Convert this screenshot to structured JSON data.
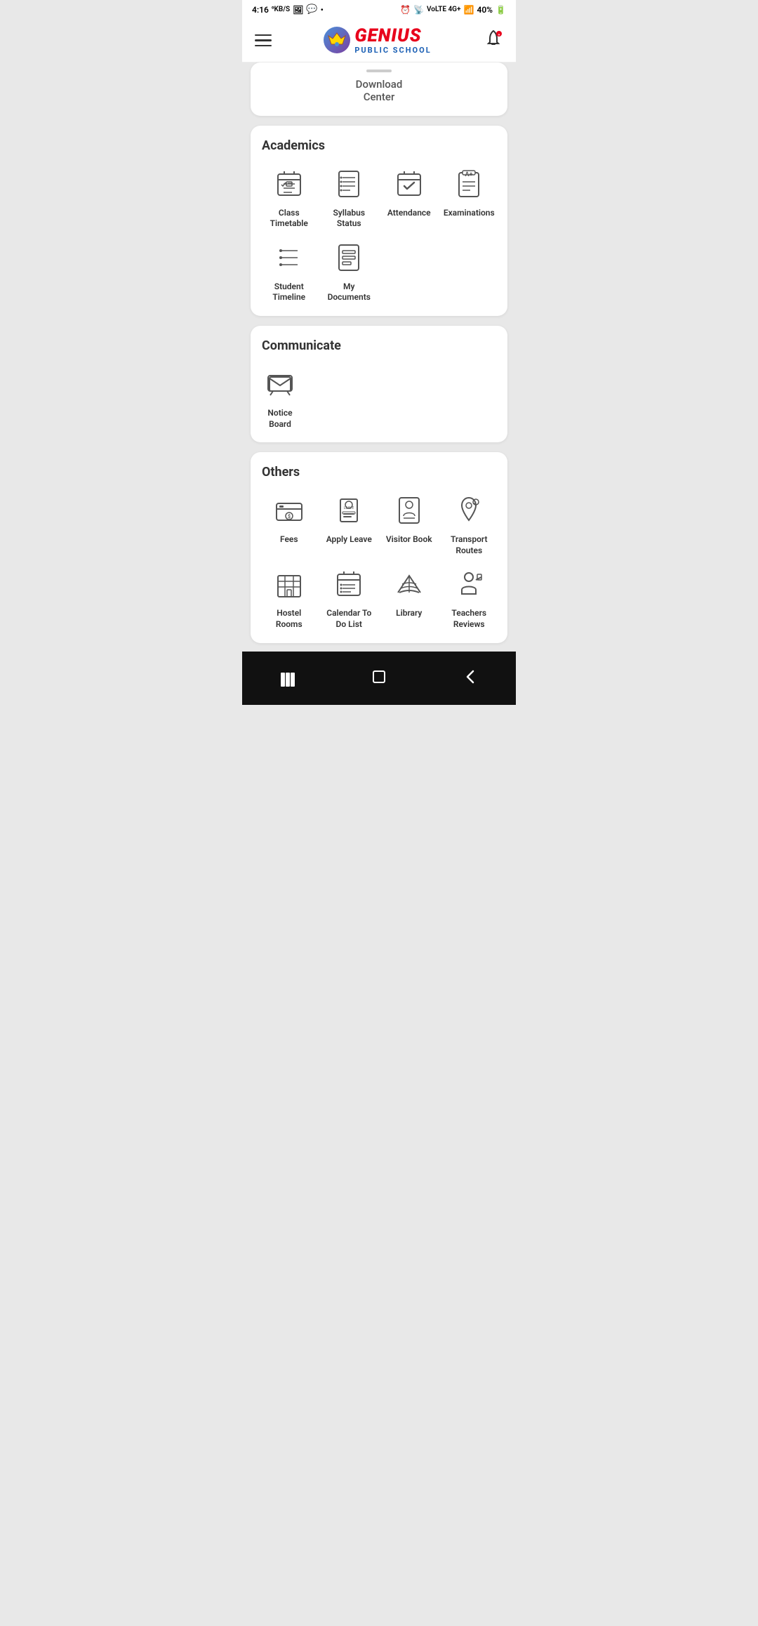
{
  "statusBar": {
    "time": "4:16",
    "networkSpeed": "KB/S",
    "battery": "40%",
    "network": "4G+"
  },
  "header": {
    "logoName": "GENIUS",
    "logoSub": "PUBLIC SCHOOL"
  },
  "partialCard": {
    "text": "Download\nCenter"
  },
  "academics": {
    "sectionTitle": "Academics",
    "items": [
      {
        "id": "class-timetable",
        "label": "Class\nTimetable"
      },
      {
        "id": "syllabus-status",
        "label": "Syllabus\nStatus"
      },
      {
        "id": "attendance",
        "label": "Attendance"
      },
      {
        "id": "examinations",
        "label": "Examinations"
      },
      {
        "id": "student-timeline",
        "label": "Student\nTimeline"
      },
      {
        "id": "my-documents",
        "label": "My\nDocuments"
      }
    ]
  },
  "communicate": {
    "sectionTitle": "Communicate",
    "items": [
      {
        "id": "notice-board",
        "label": "Notice\nBoard"
      }
    ]
  },
  "others": {
    "sectionTitle": "Others",
    "items": [
      {
        "id": "fees",
        "label": "Fees"
      },
      {
        "id": "apply-leave",
        "label": "Apply Leave"
      },
      {
        "id": "visitor-book",
        "label": "Visitor Book"
      },
      {
        "id": "transport-routes",
        "label": "Transport\nRoutes"
      },
      {
        "id": "hostel-rooms",
        "label": "Hostel\nRooms"
      },
      {
        "id": "calendar-todo",
        "label": "Calendar To\nDo List"
      },
      {
        "id": "library",
        "label": "Library"
      },
      {
        "id": "teachers-reviews",
        "label": "Teachers\nReviews"
      }
    ]
  },
  "bottomNav": {
    "items": [
      "menu",
      "home",
      "back"
    ]
  }
}
